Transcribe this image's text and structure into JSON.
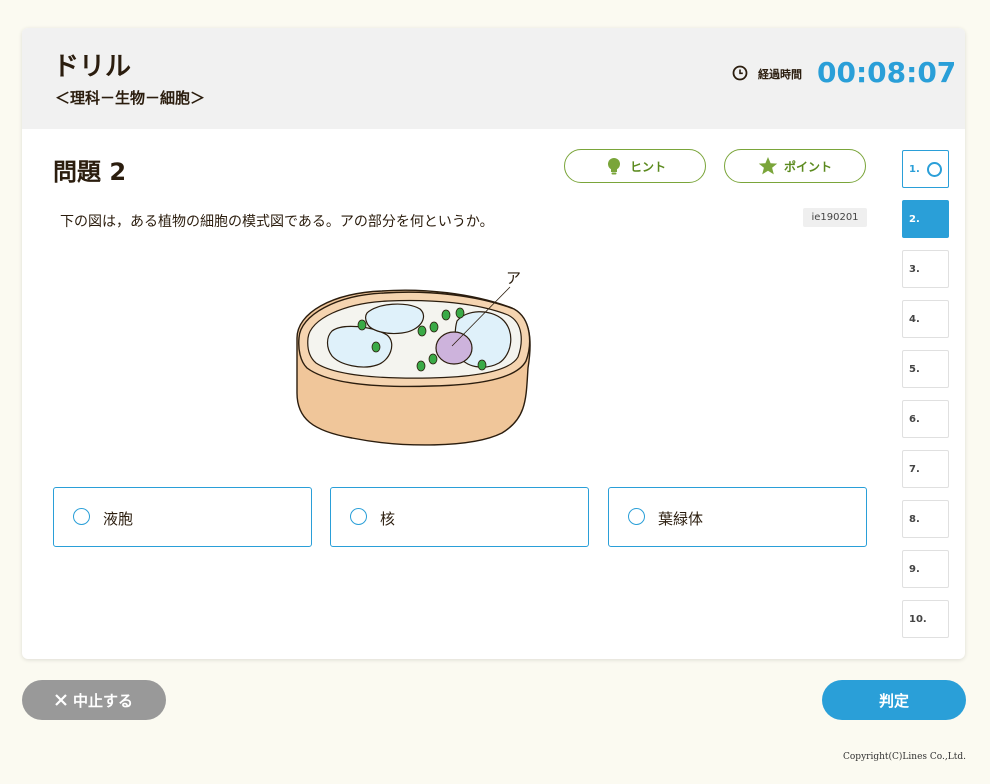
{
  "header": {
    "title": "ドリル",
    "subtitle": "＜理科－生物－細胞＞",
    "timer_label": "経過時間",
    "timer_value": "00:08:07",
    "timer_icon": "clock-icon"
  },
  "question": {
    "title": "問題 2",
    "text": "下の図は，ある植物の細胞の模式図である。アの部分を何というか。",
    "id": "ie190201",
    "diagram_label": "ア"
  },
  "toolbar": {
    "hint_label": "ヒント",
    "hint_icon": "lightbulb-icon",
    "point_label": "ポイント",
    "point_icon": "star-icon"
  },
  "choices": [
    {
      "label": "液胞"
    },
    {
      "label": "核"
    },
    {
      "label": "葉緑体"
    }
  ],
  "nav": {
    "items": [
      {
        "label": "1.",
        "state": "answered"
      },
      {
        "label": "2.",
        "state": "current"
      },
      {
        "label": "3."
      },
      {
        "label": "4."
      },
      {
        "label": "5."
      },
      {
        "label": "6."
      },
      {
        "label": "7."
      },
      {
        "label": "8."
      },
      {
        "label": "9."
      },
      {
        "label": "10."
      }
    ]
  },
  "footer": {
    "stop_label": "中止する",
    "stop_icon": "close-icon",
    "judge_label": "判定",
    "copyright": "Copyright(C)Lines Co.,Ltd."
  },
  "colors": {
    "accent": "#2a9fd8",
    "hint_green": "#7aa53a",
    "stop_gray": "#999999",
    "cell_wall": "#f0c69a",
    "chloroplast": "#3aaa47",
    "nucleus": "#cdb3dc",
    "vacuole": "#dff1fa"
  }
}
